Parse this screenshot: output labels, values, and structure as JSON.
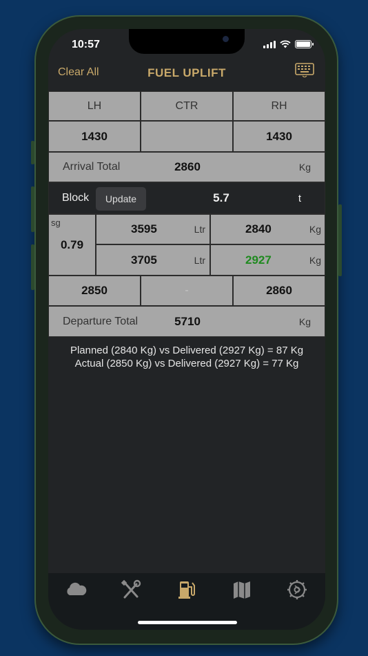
{
  "status": {
    "time": "10:57"
  },
  "nav": {
    "left": "Clear All",
    "title": "FUEL UPLIFT"
  },
  "tanks": {
    "lh": "LH",
    "ctr": "CTR",
    "rh": "RH"
  },
  "arrival": {
    "lh": "1430",
    "ctr": "",
    "rh": "1430",
    "label": "Arrival Total",
    "total": "2860",
    "unit": "Kg"
  },
  "block": {
    "label": "Block",
    "button": "Update",
    "value": "5.7",
    "unit": "t"
  },
  "sg": {
    "label": "sg",
    "value": "0.79"
  },
  "uplift": {
    "r1": {
      "ltr": "3595",
      "ltr_unit": "Ltr",
      "kg": "2840",
      "kg_unit": "Kg"
    },
    "r2": {
      "ltr": "3705",
      "ltr_unit": "Ltr",
      "kg": "2927",
      "kg_unit": "Kg"
    }
  },
  "departure": {
    "lh": "2850",
    "ctr": "-",
    "rh": "2860",
    "label": "Departure Total",
    "total": "5710",
    "unit": "Kg"
  },
  "summary": {
    "line1": "Planned (2840 Kg) vs Delivered (2927 Kg) = 87 Kg",
    "line2": "Actual (2850 Kg) vs Delivered (2927 Kg) = 77 Kg"
  },
  "colors": {
    "accent": "#c9a96a",
    "delivered": "#1f8a1f"
  },
  "tabbar": {
    "icons": [
      "cloud-icon",
      "tools-icon",
      "fuel-pump-icon",
      "map-icon",
      "gear-icon"
    ],
    "active": "fuel-pump-icon"
  }
}
